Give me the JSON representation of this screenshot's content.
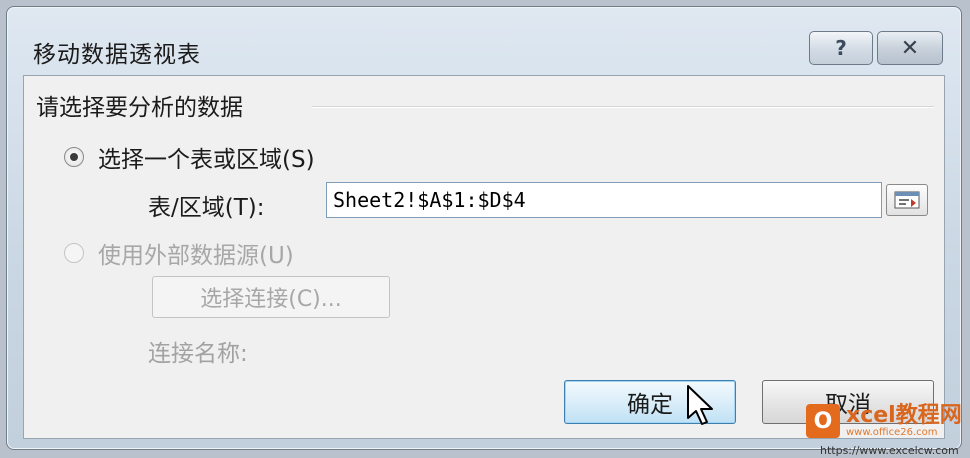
{
  "dialog": {
    "title": "移动数据透视表",
    "help_label": "?",
    "close_label": "✕"
  },
  "group": {
    "label": "请选择要分析的数据"
  },
  "option_table": {
    "label": "选择一个表或区域(S)",
    "checked": true
  },
  "table_range": {
    "label": "表/区域(T):",
    "value": "Sheet2!$A$1:$D$4"
  },
  "option_external": {
    "label": "使用外部数据源(U)",
    "checked": false
  },
  "choose_connection": {
    "label": "选择连接(C)..."
  },
  "connection_name": {
    "label": "连接名称:"
  },
  "buttons": {
    "ok": "确定",
    "cancel": "取消"
  },
  "watermark": {
    "logo_letter": "O",
    "name": "xcel教程网",
    "url1": "www.office26.com",
    "url2": "https://www.excelcw.com"
  }
}
